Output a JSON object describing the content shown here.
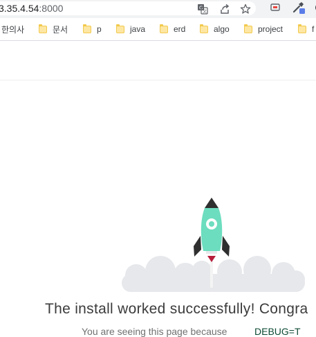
{
  "browser": {
    "url_host": "3.35.4.54",
    "url_port": ":8000",
    "icons": [
      "translate-icon",
      "share-icon",
      "star-icon",
      "cast-icon",
      "extension-icon"
    ]
  },
  "bookmarks": [
    {
      "label": "한의사",
      "has_folder": false
    },
    {
      "label": "문서"
    },
    {
      "label": "p"
    },
    {
      "label": "java"
    },
    {
      "label": "erd"
    },
    {
      "label": "algo"
    },
    {
      "label": "project"
    },
    {
      "label": "f"
    }
  ],
  "page": {
    "headline": "The install worked successfully! Congra",
    "subline": "You are seeing this page because",
    "subline_link": "DEBUG=T"
  },
  "colors": {
    "rocket_body": "#6dddbf",
    "rocket_dark": "#2f2f2f",
    "flame": "#b71c3b",
    "cloud": "#e6e8eb"
  }
}
